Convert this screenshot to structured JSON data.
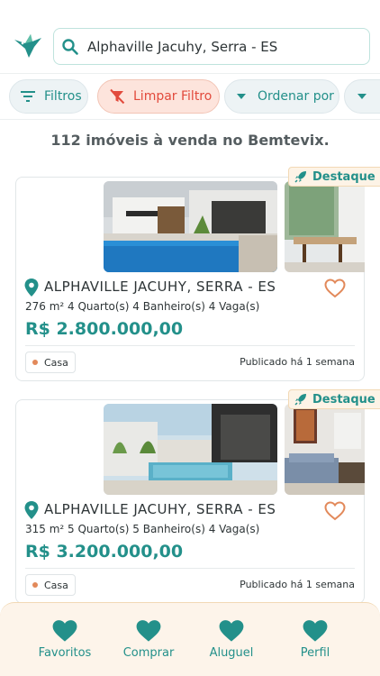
{
  "colors": {
    "accent": "#23908a",
    "danger": "#e24a3c",
    "highlight_bg": "#fdf3e6",
    "heart_outline": "#e2895a"
  },
  "header": {
    "logo_icon": "bird-logo-icon",
    "search": {
      "value": "Alphaville Jacuhy, Serra - ES",
      "icon": "search-icon"
    }
  },
  "filters": {
    "items": [
      {
        "label": "Filtros",
        "icon": "filter-lines-icon"
      },
      {
        "label": "Limpar Filtro",
        "icon": "filter-off-icon"
      },
      {
        "label": "Ordenar por",
        "icon": "caret-down-icon"
      },
      {
        "label": "",
        "icon": "caret-down-icon"
      }
    ]
  },
  "results": {
    "count_text": "112 imóveis à venda no Bemtevix."
  },
  "listings": [
    {
      "badge": "Destaque",
      "location": "ALPHAVILLE JACUHY, SERRA - ES",
      "specs": "276 m²  4 Quarto(s)  4 Banheiro(s)  4 Vaga(s)",
      "price": "R$ 2.800.000,00",
      "type": "Casa",
      "published": "Publicado há 1 semana"
    },
    {
      "badge": "Destaque",
      "location": "ALPHAVILLE JACUHY, SERRA - ES",
      "specs": "315 m²  5 Quarto(s)  5 Banheiro(s)  4 Vaga(s)",
      "price": "R$ 3.200.000,00",
      "type": "Casa",
      "published": "Publicado há 1 semana"
    }
  ],
  "bottom_nav": {
    "items": [
      {
        "label": "Favoritos",
        "icon": "heart-icon"
      },
      {
        "label": "Comprar",
        "icon": "heart-icon"
      },
      {
        "label": "Aluguel",
        "icon": "heart-icon"
      },
      {
        "label": "Perfil",
        "icon": "heart-icon"
      }
    ]
  }
}
